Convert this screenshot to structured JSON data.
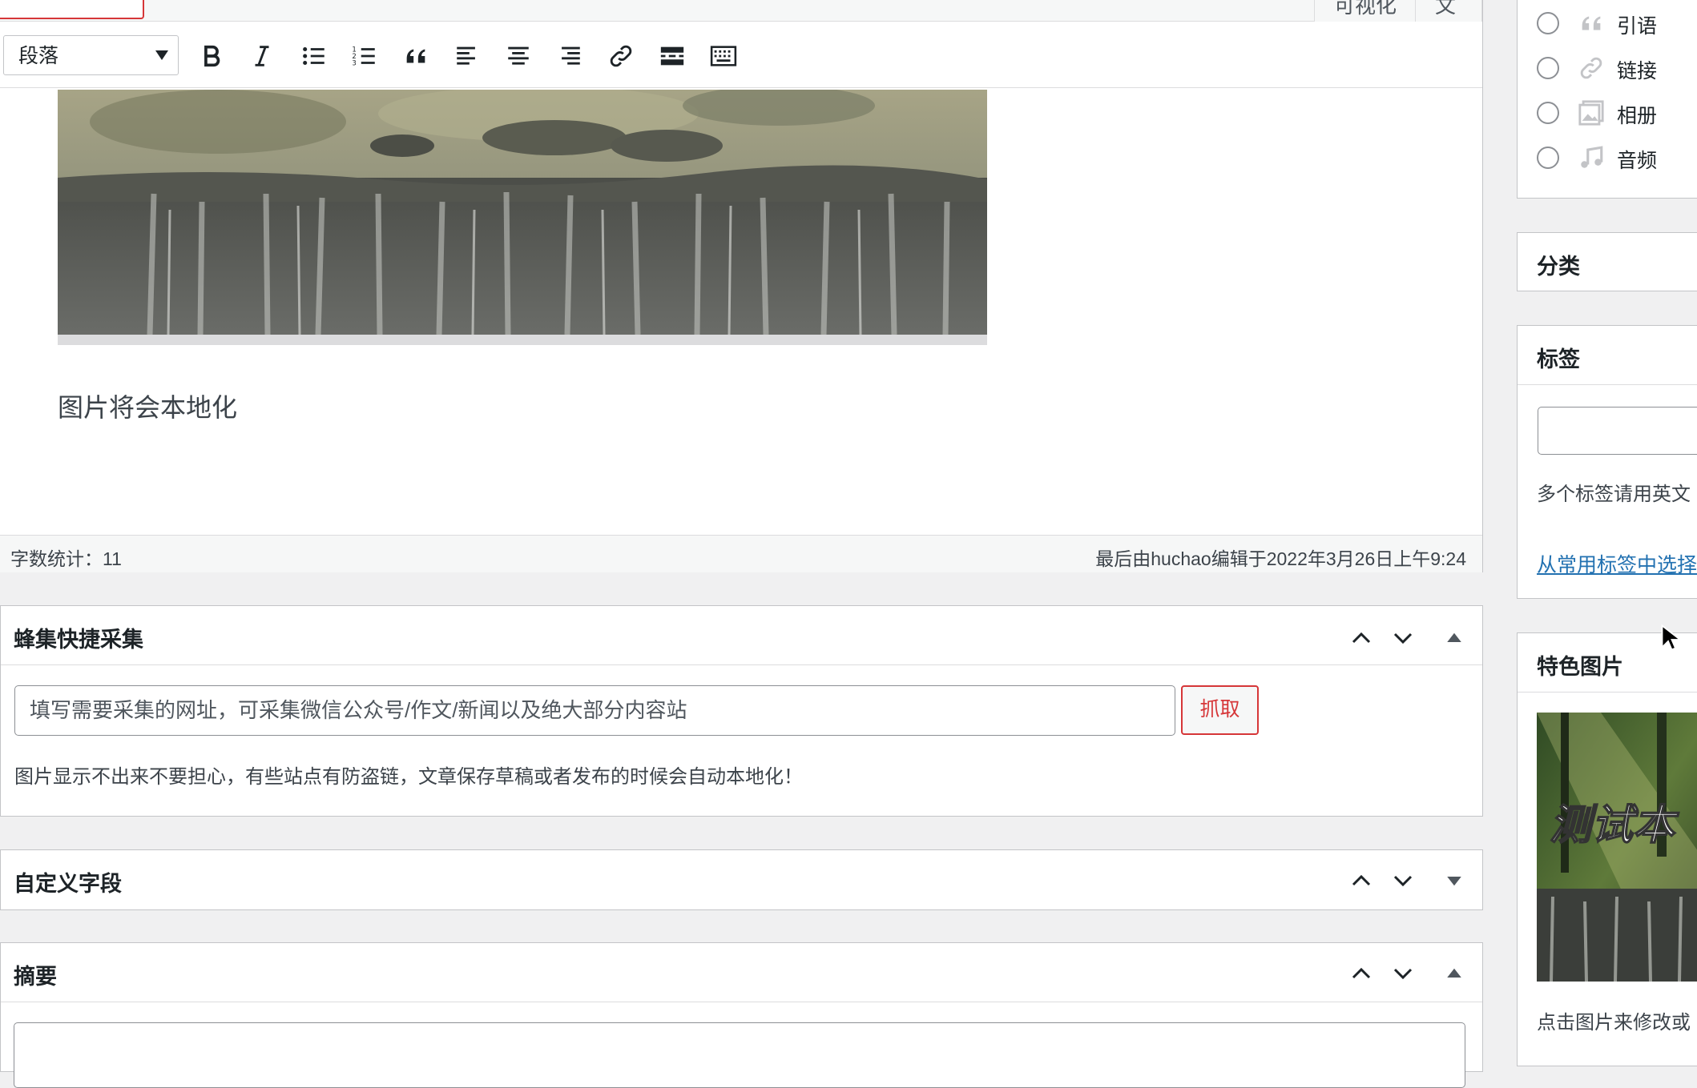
{
  "editor": {
    "tabs": {
      "visual": "可视化",
      "text": "文本"
    },
    "format_select": "段落",
    "caption": "图片将会本地化",
    "word_count": "字数统计：11",
    "last_edit": "最后由huchao编辑于2022年3月26日上午9:24"
  },
  "boxes": {
    "collector": {
      "title": "蜂集快捷采集",
      "placeholder": "填写需要采集的网址，可采集微信公众号/作文/新闻以及绝大部分内容站",
      "button": "抓取",
      "help": "图片显示不出来不要担心，有些站点有防盗链，文章保存草稿或者发布的时候会自动本地化！"
    },
    "custom_fields": {
      "title": "自定义字段"
    },
    "excerpt": {
      "title": "摘要"
    }
  },
  "sidebar": {
    "formats": [
      {
        "label": "引语",
        "icon": "quote-icon"
      },
      {
        "label": "链接",
        "icon": "link-icon"
      },
      {
        "label": "相册",
        "icon": "gallery-icon"
      },
      {
        "label": "音频",
        "icon": "audio-icon"
      }
    ],
    "categories_title": "分类",
    "tags": {
      "title": "标签",
      "help": "多个标签请用英文",
      "choose_link": "从常用标签中选择"
    },
    "featured": {
      "title": "特色图片",
      "image_text": "测试本",
      "help": "点击图片来修改或"
    }
  },
  "colors": {
    "accent": "#d63638",
    "link": "#2271b1",
    "border": "#c3c4c7"
  }
}
